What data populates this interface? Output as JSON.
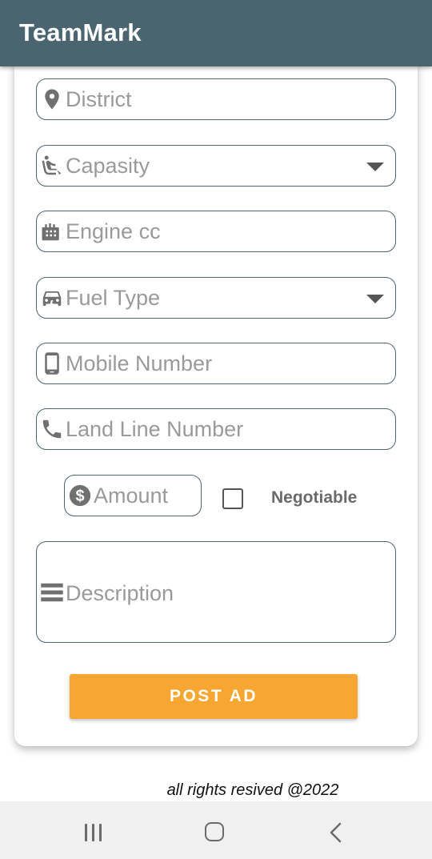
{
  "app": {
    "title": "TeamMark"
  },
  "form": {
    "district": {
      "placeholder": "District",
      "icon": "location-pin-icon"
    },
    "capacity": {
      "placeholder": "Capasity",
      "icon": "seat-icon"
    },
    "engine": {
      "placeholder": "Engine cc",
      "icon": "engine-icon"
    },
    "fuel": {
      "placeholder": "Fuel Type",
      "icon": "car-charge-icon"
    },
    "mobile": {
      "placeholder": "Mobile Number",
      "icon": "phone-android-icon"
    },
    "landline": {
      "placeholder": "Land Line Number",
      "icon": "phone-icon"
    },
    "amount": {
      "placeholder": "Amount",
      "icon": "dollar-circle-icon"
    },
    "negotiable": {
      "label": "Negotiable",
      "checked": false
    },
    "description": {
      "placeholder": "Description",
      "icon": "lines-icon"
    },
    "submit": {
      "label": "POST AD"
    }
  },
  "footer": {
    "text": "all rights resived @2022"
  },
  "colors": {
    "appbar": "#4a6470",
    "accent": "#f7a731",
    "border": "#4e6470"
  }
}
